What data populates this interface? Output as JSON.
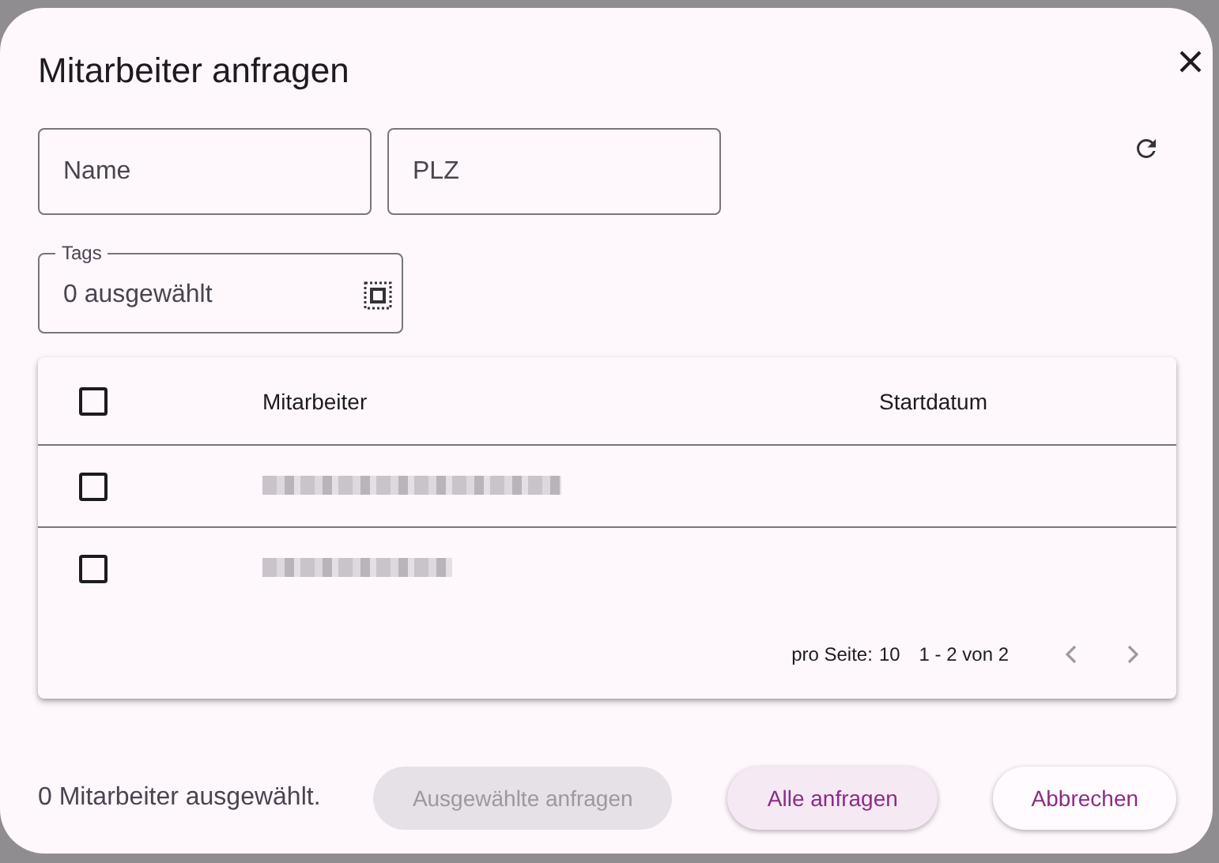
{
  "dialog": {
    "title": "Mitarbeiter anfragen"
  },
  "filters": [
    {
      "placeholder": "Name"
    },
    {
      "placeholder": "PLZ"
    }
  ],
  "tags_field": {
    "label": "Tags",
    "value": "0 ausgewählt"
  },
  "table": {
    "select_all": {
      "checked": false
    },
    "columns": [
      "Mitarbeiter",
      "Startdatum"
    ],
    "rows": [
      {
        "checked": false
      },
      {
        "checked": false
      }
    ]
  },
  "paginator": {
    "page_size_label": "pro Seite:",
    "page_size": "10",
    "range": "1 - 2 von 2",
    "prev_disabled": true,
    "next_disabled": true
  },
  "footer": {
    "summary": "0 Mitarbeiter ausgewählt.",
    "buttons": [
      {
        "label": "Ausgewählte anfragen",
        "kind": "flat",
        "disabled": true
      },
      {
        "label": "Alle anfragen",
        "kind": "tonal",
        "disabled": false
      },
      {
        "label": "Abbrechen",
        "kind": "elevated",
        "disabled": false
      }
    ]
  }
}
